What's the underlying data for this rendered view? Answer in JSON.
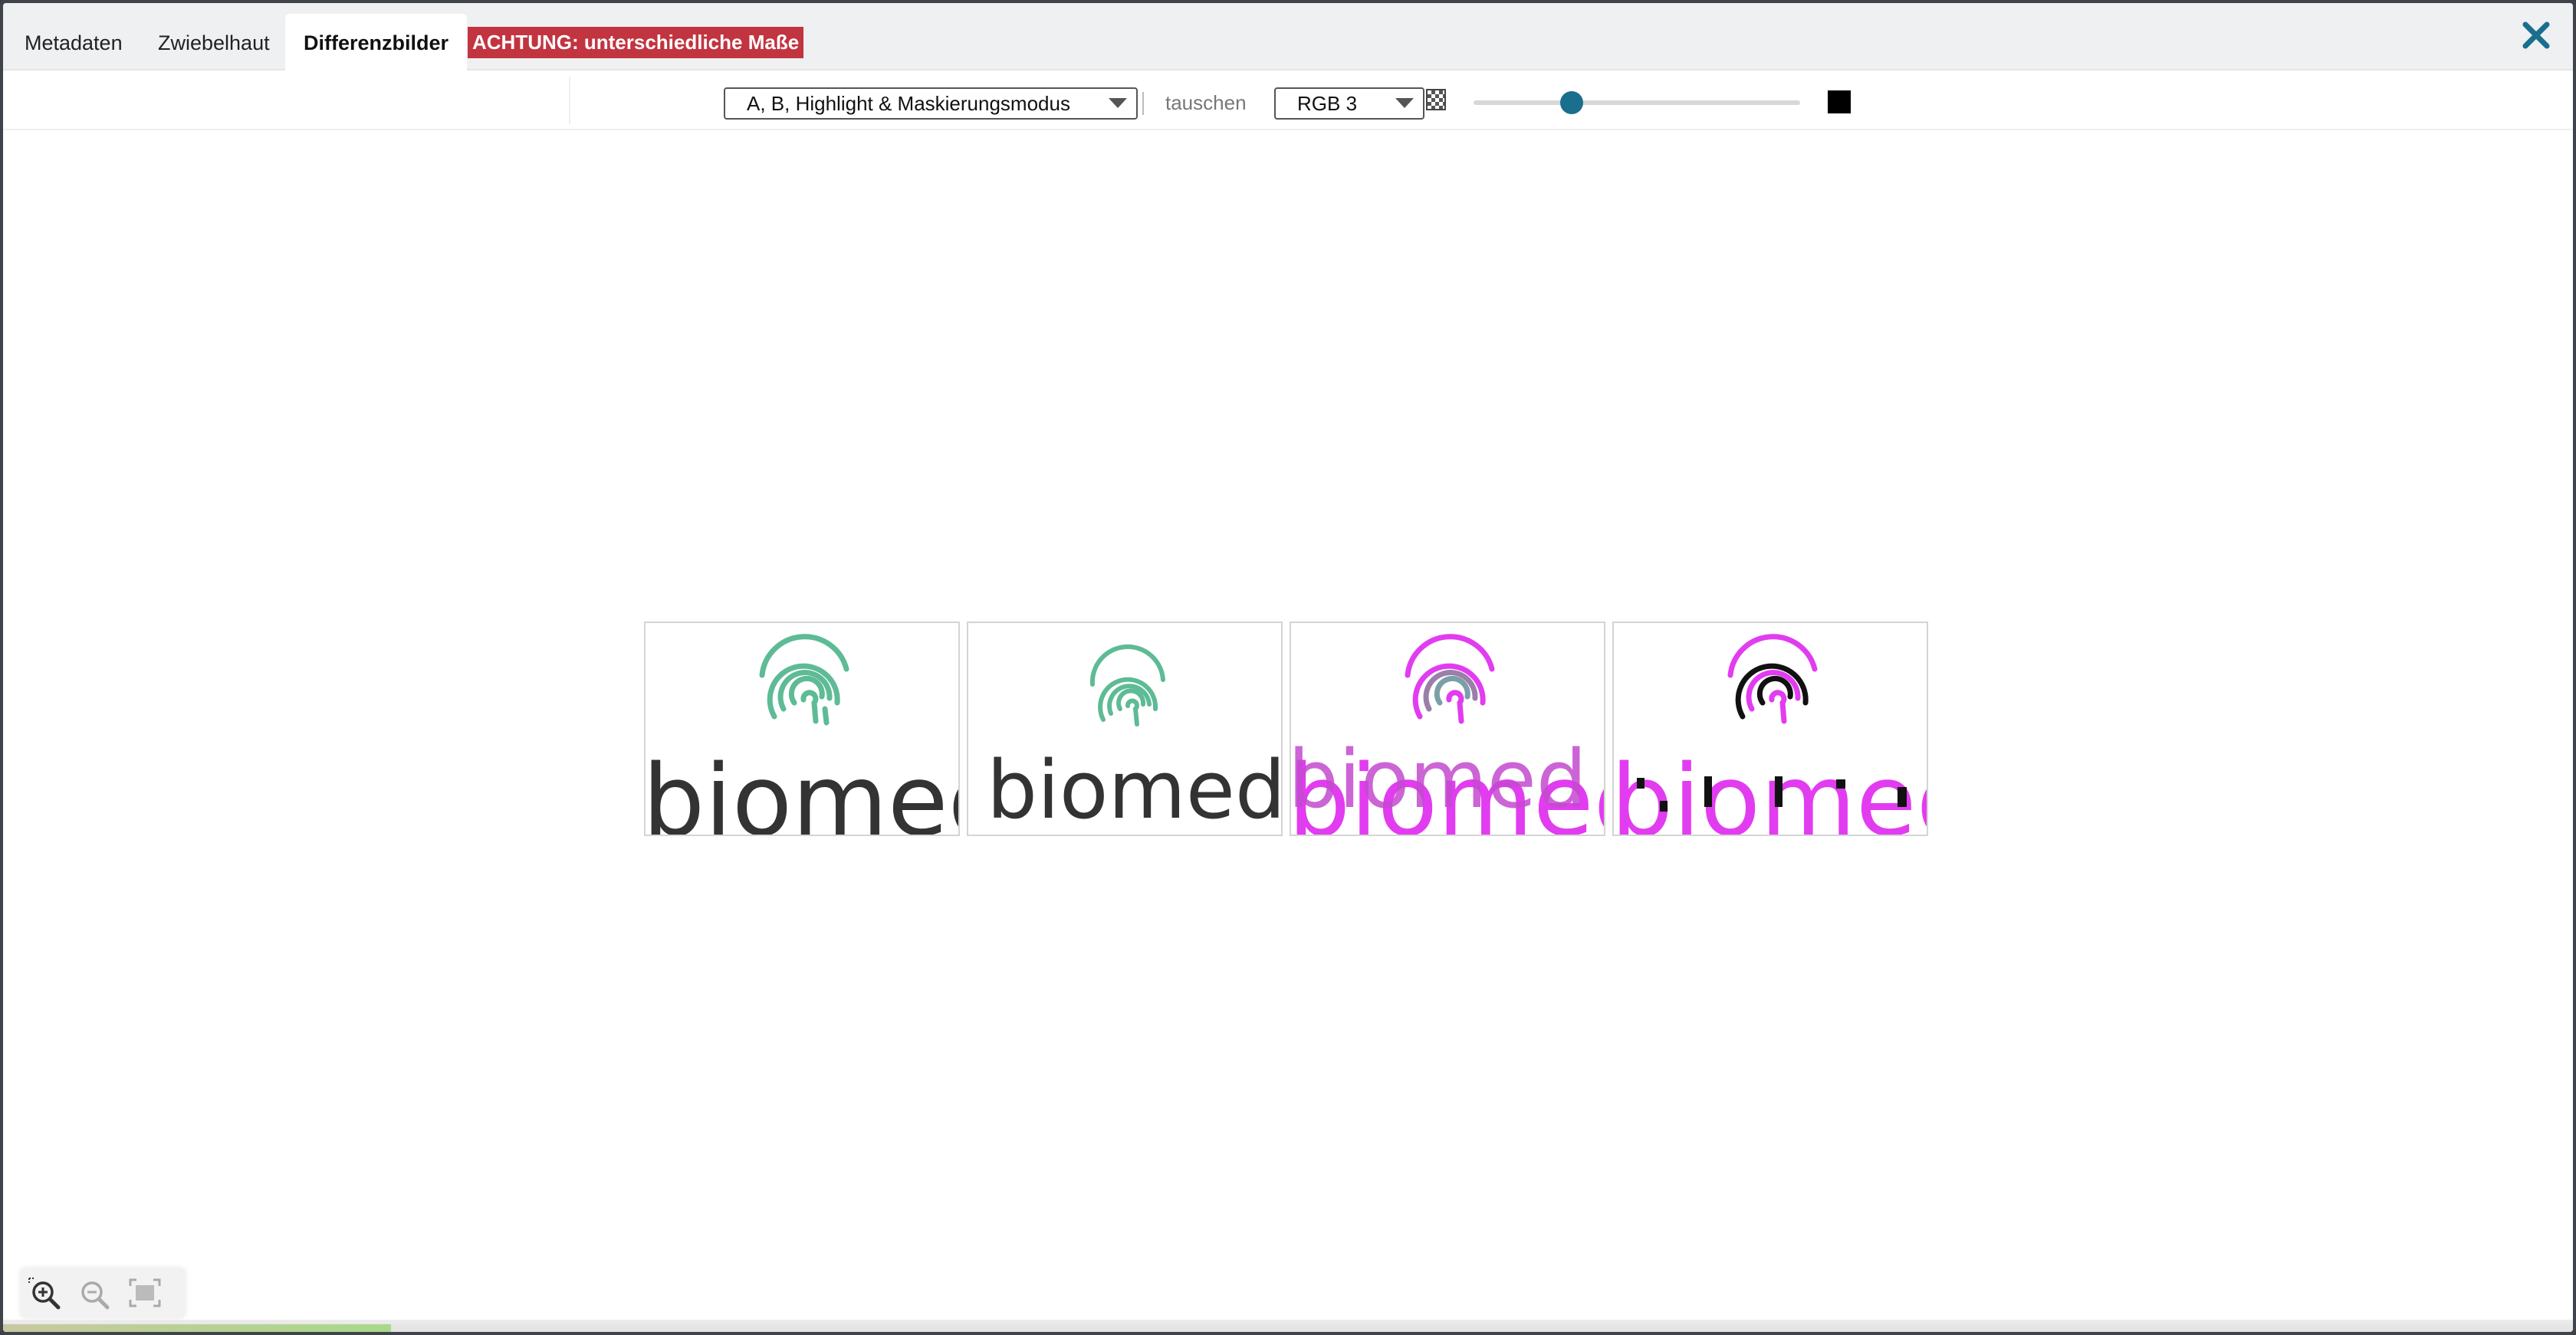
{
  "tabs": [
    {
      "label": "Metadaten",
      "active": false
    },
    {
      "label": "Zwiebelhaut",
      "active": false
    },
    {
      "label": "Differenzbilder",
      "active": true
    }
  ],
  "warning": "ACHTUNG: unterschiedliche Maße",
  "toolbar": {
    "mode_select": "A, B, Highlight & Maskierungsmodus",
    "swap_label": "tauschen",
    "channel_select": "RGB 3",
    "slider_value": 0.3,
    "mask_color": "#000000"
  },
  "panels": [
    {
      "word": "biomed"
    },
    {
      "word": "biomed"
    },
    {
      "word": "biomed"
    },
    {
      "word": "biomed"
    }
  ],
  "colors": {
    "accent": "#1a6e8e",
    "warning": "#c2343f",
    "fingerprint": "#5dbb95",
    "highlight": "#e23cf0"
  },
  "icons": {
    "close": "close-icon",
    "zoom_in": "zoom-in-icon",
    "zoom_out": "zoom-out-icon",
    "fit": "fit-screen-icon"
  }
}
